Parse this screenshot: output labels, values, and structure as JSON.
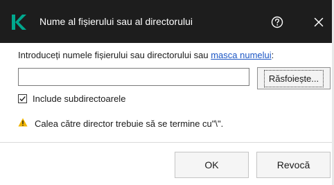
{
  "titlebar": {
    "title": "Nume al fișierului sau al directorului",
    "logo_icon": "kaspersky-k-logo",
    "help_icon": "help-icon",
    "close_icon": "close-icon",
    "logo_color": "#00a88e"
  },
  "main": {
    "prompt_text": "Introduceți numele fișierului sau directorului sau ",
    "prompt_link": "masca numelui",
    "prompt_suffix": ":",
    "path_input_value": "",
    "path_input_placeholder": "",
    "browse_label": "Răsfoiește...",
    "include_subdirs_label": "Include subdirectoarele",
    "include_subdirs_checked": true,
    "warning_icon": "warning-icon",
    "warning_color": "#f0b400",
    "warning_text": "Calea către director trebuie să se termine cu\"\\\"."
  },
  "footer": {
    "ok_label": "OK",
    "cancel_label": "Revocă"
  }
}
